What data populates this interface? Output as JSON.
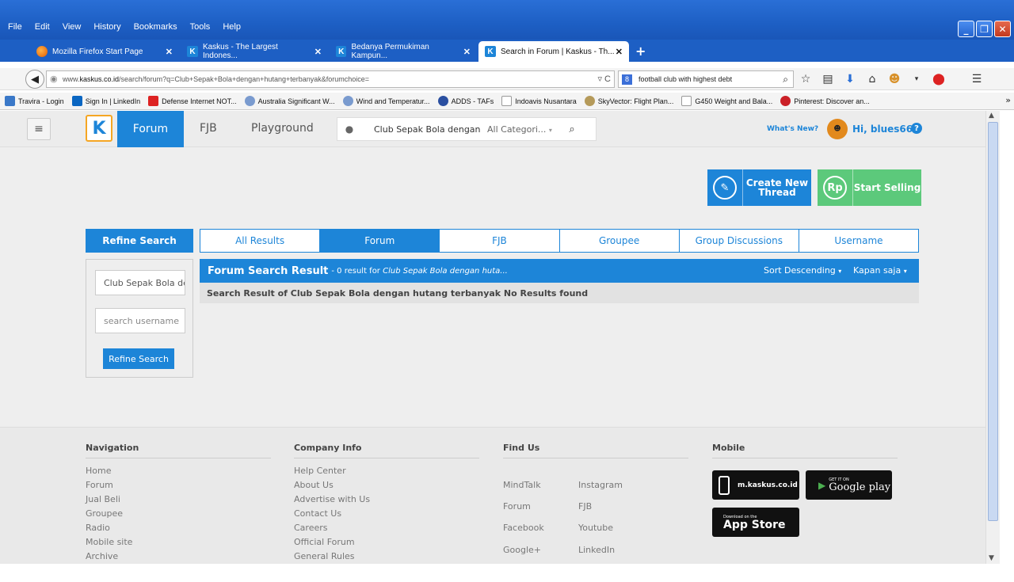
{
  "browser": {
    "menu": [
      "File",
      "Edit",
      "View",
      "History",
      "Bookmarks",
      "Tools",
      "Help"
    ],
    "tabs": [
      {
        "title": "Mozilla Firefox Start Page",
        "active": false
      },
      {
        "title": "Kaskus - The Largest Indones...",
        "active": false
      },
      {
        "title": "Bedanya Permukiman Kampun...",
        "active": false
      },
      {
        "title": "Search in Forum | Kaskus - Th...",
        "active": true
      }
    ],
    "url_prefix": "www.",
    "url_domain": "kaskus.co.id",
    "url_rest": "/search/forum?q=Club+Sepak+Bola+dengan+hutang+terbanyak&forumchoice=",
    "search_value": "football club with highest debt",
    "bookmarks": [
      "Travira - Login",
      "Sign In | LinkedIn",
      "Defense Internet NOT...",
      "Australia Significant W...",
      "Wind and Temperatur...",
      "ADDS - TAFs",
      "Indoavis Nusantara",
      "SkyVector: Flight Plan...",
      "G450 Weight and Bala...",
      "Pinterest: Discover an..."
    ]
  },
  "header": {
    "nav_forum": "Forum",
    "nav_fjb": "FJB",
    "nav_playground": "Playground",
    "search_query": "Club Sepak Bola dengan hu",
    "category": "All Categori...",
    "whats_new": "What's New?",
    "greeting": "Hi, blues66"
  },
  "actions": {
    "create_thread": "Create New\nThread",
    "start_selling": "Start Selling",
    "rp_icon": "Rp"
  },
  "refine": {
    "title": "Refine Search",
    "query_value": "Club Sepak Bola de",
    "username_placeholder": "search username",
    "button": "Refine Search"
  },
  "result_tabs": [
    "All Results",
    "Forum",
    "FJB",
    "Groupee",
    "Group Discussions",
    "Username"
  ],
  "results": {
    "title": "Forum Search Result",
    "meta_prefix": " - 0 result for ",
    "meta_query": "Club Sepak Bola dengan huta...",
    "sort": "Sort Descending",
    "time": "Kapan saja",
    "message": "Search Result of Club Sepak Bola dengan hutang terbanyak No Results found"
  },
  "footer": {
    "navigation": {
      "title": "Navigation",
      "items": [
        "Home",
        "Forum",
        "Jual Beli",
        "Groupee",
        "Radio",
        "Mobile site",
        "Archive"
      ]
    },
    "company": {
      "title": "Company Info",
      "items": [
        "Help Center",
        "About Us",
        "Advertise with Us",
        "Contact Us",
        "Careers",
        "Official Forum",
        "General Rules"
      ]
    },
    "findus": {
      "title": "Find Us",
      "items": [
        "MindTalk",
        "Instagram",
        "Forum",
        "FJB",
        "Facebook",
        "Youtube",
        "Google+",
        "LinkedIn"
      ]
    },
    "mobile": {
      "title": "Mobile",
      "mkaskus": "m.kaskus.co.id",
      "gplay_sub": "GET IT ON",
      "gplay_main": "Google play",
      "appstore_sub": "Download on the",
      "appstore_main": "App Store"
    }
  },
  "colors": {
    "accent": "#1d85d8",
    "sell": "#5cc97b",
    "logo_border": "#f5a623"
  }
}
